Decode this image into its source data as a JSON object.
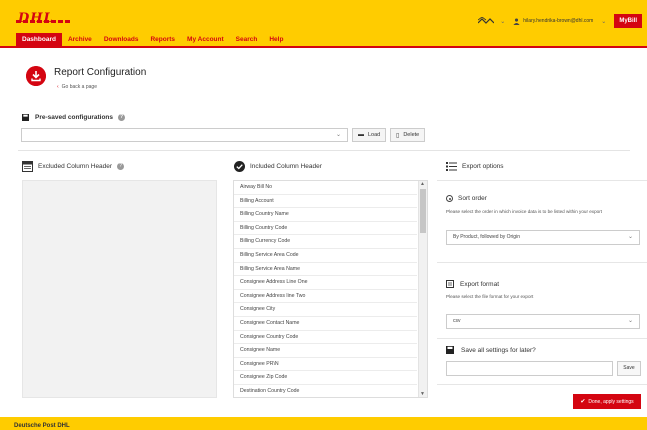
{
  "header": {
    "logo": "DHL",
    "user_email": "hilary.hendrika-brown@dhl.com",
    "mybill_label": "MyBill",
    "nav": [
      "Dashboard",
      "Archive",
      "Downloads",
      "Reports",
      "My Account",
      "Search",
      "Help"
    ],
    "active_nav": "Dashboard",
    "brand_yellow": "#ffcc00",
    "brand_red": "#d40511"
  },
  "page": {
    "title": "Report Configuration",
    "back_link": "Go back a page"
  },
  "presaved": {
    "label": "Pre-saved configurations",
    "select_value": "",
    "load_label": "Load",
    "delete_label": "Delete"
  },
  "excluded": {
    "label": "Excluded Column Header"
  },
  "included": {
    "label": "Included Column Header",
    "items": [
      "Airway Bill No",
      "Billing Account",
      "Billing Country Name",
      "Billing Country Code",
      "Billing Currency Code",
      "Billing Service Area Code",
      "Billing Service Area Name",
      "Consignee Address Line One",
      "Consignee Address line Two",
      "Consignee City",
      "Consignee Contact Name",
      "Consignee Country Code",
      "Consignee Name",
      "Consignee PR\\N",
      "Consignee Zip Code",
      "Destination Country Code"
    ]
  },
  "export": {
    "title": "Export options",
    "sort_label": "Sort order",
    "sort_desc": "Please select the order in which invoice data is to be listed within your export",
    "sort_value": "By Product, followed by Origin",
    "format_label": "Export format",
    "format_desc": "Please select the file format for your export",
    "format_value": "csv",
    "save_label": "Save all settings for later?",
    "save_input_value": "",
    "save_button": "Save",
    "done_button": "Done, apply settings"
  },
  "footer": {
    "text": "Deutsche Post DHL"
  }
}
